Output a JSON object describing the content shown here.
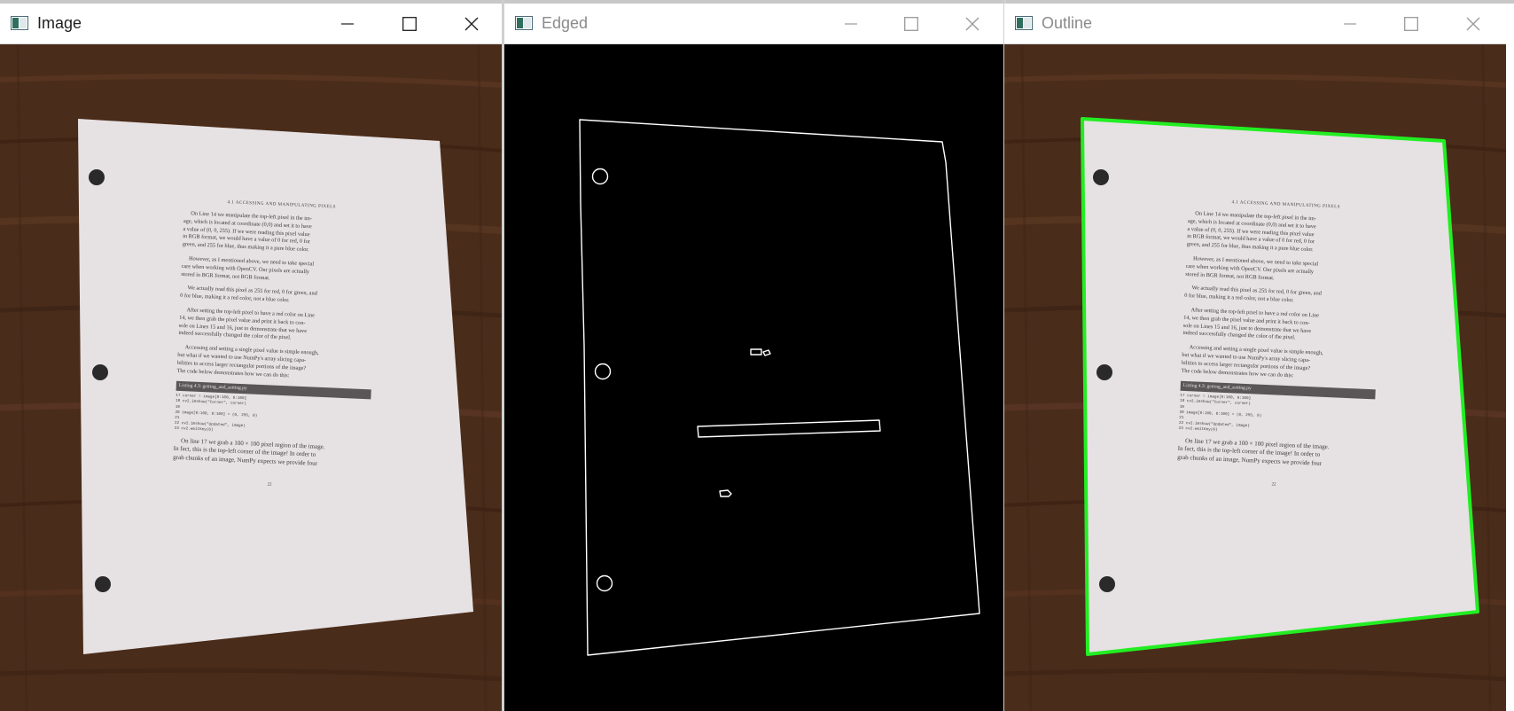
{
  "windows": [
    {
      "title": "Image",
      "active": true
    },
    {
      "title": "Edged",
      "active": false
    },
    {
      "title": "Outline",
      "active": false
    }
  ],
  "page": {
    "header": "4.1 ACCESSING AND MANIPULATING PIXELS",
    "paragraphs": [
      [
        "On Line 14 we manipulate the top-left pixel in the im-",
        "age, which is located at coordinate (0,0) and set it to have",
        "a value of (0, 0, 255). If we were reading this pixel value",
        "in RGB format, we would have a value of 0 for red, 0 for",
        "green, and 255 for blue, thus making it a pure blue color."
      ],
      [
        "However, as I mentioned above, we need to take special",
        "care when working with OpenCV. Our pixels are actually",
        "stored in BGR format, not RGB format."
      ],
      [
        "We actually read this pixel as 255 for red, 0 for green, and",
        "0 for blue, making it a red color, not a blue color."
      ],
      [
        "After setting the top-left pixel to have a red color on Line",
        "14, we then grab the pixel value and print it back to con-",
        "sole on Lines 15 and 16, just to demonstrate that we have",
        "indeed successfully changed the color of the pixel."
      ],
      [
        "Accessing and setting a single pixel value is simple enough,",
        "but what if we wanted to use NumPy's array slicing capa-",
        "bilities to access larger rectangular portions of the image?",
        "The code below demonstrates how we can do this:"
      ]
    ],
    "listing_title": "Listing 4.3: getting_and_setting.py",
    "code": [
      "17 corner = image[0:100, 0:100]",
      "18 cv2.imshow(\"Corner\", corner)",
      "19",
      "20 image[0:100, 0:100] = (0, 255, 0)",
      "21",
      "22 cv2.imshow(\"Updated\", image)",
      "23 cv2.waitKey(0)"
    ],
    "closing": [
      "On line 17 we grab a 100 × 100 pixel region of the image.",
      "In fact, this is the top-left corner of the image! In order to",
      "grab chunks of an image, NumPy expects we provide four"
    ],
    "page_number": "22"
  },
  "colors": {
    "outline": "#22ee22",
    "wood": "#4a2c1a",
    "paper": "#e9e4e4",
    "edge_bg": "#000000",
    "edge_line": "#ffffff"
  },
  "icons": [
    "app-icon",
    "minimize-icon",
    "maximize-icon",
    "close-icon"
  ]
}
